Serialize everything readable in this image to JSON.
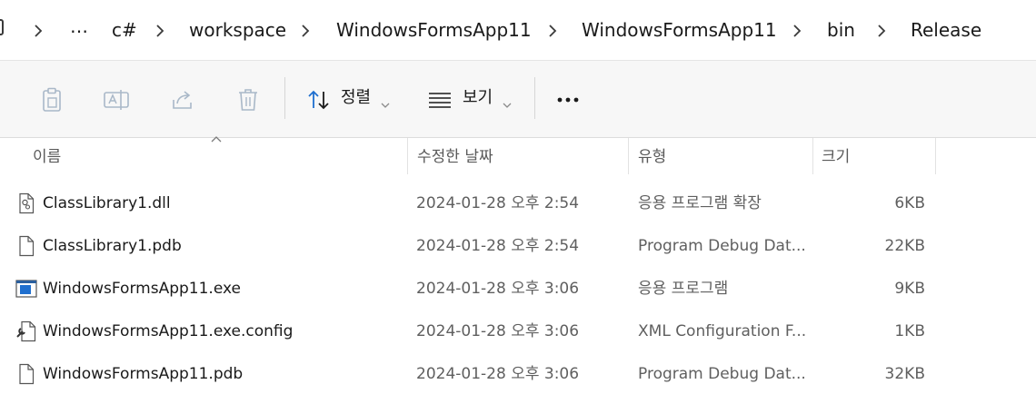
{
  "breadcrumb": {
    "items": [
      "…",
      "c#",
      "workspace",
      "WindowsFormsApp11",
      "WindowsFormsApp11",
      "bin",
      "Release"
    ]
  },
  "toolbar": {
    "copy_icon": "copy-icon",
    "rename_icon": "rename-icon",
    "share_icon": "share-icon",
    "delete_icon": "delete-icon",
    "sort_label": "정렬",
    "view_label": "보기",
    "more_label": "..."
  },
  "columns": {
    "name": "이름",
    "date": "수정한 날짜",
    "type": "유형",
    "size": "크기"
  },
  "files": [
    {
      "name": "ClassLibrary1.dll",
      "date": "2024-01-28 오후 2:54",
      "type": "응용 프로그램 확장",
      "size": "6KB",
      "icon": "dll-file-icon"
    },
    {
      "name": "ClassLibrary1.pdb",
      "date": "2024-01-28 오후 2:54",
      "type": "Program Debug Dat...",
      "size": "22KB",
      "icon": "file-icon"
    },
    {
      "name": "WindowsFormsApp11.exe",
      "date": "2024-01-28 오후 3:06",
      "type": "응용 프로그램",
      "size": "9KB",
      "icon": "exe-file-icon"
    },
    {
      "name": "WindowsFormsApp11.exe.config",
      "date": "2024-01-28 오후 3:06",
      "type": "XML Configuration F...",
      "size": "1KB",
      "icon": "config-file-icon"
    },
    {
      "name": "WindowsFormsApp11.pdb",
      "date": "2024-01-28 오후 3:06",
      "type": "Program Debug Dat...",
      "size": "32KB",
      "icon": "file-icon"
    }
  ],
  "colors": {
    "accent": "#1f6fcf",
    "disabled_icon": "#a9b8c8",
    "muted_text": "#5f5f5f"
  }
}
